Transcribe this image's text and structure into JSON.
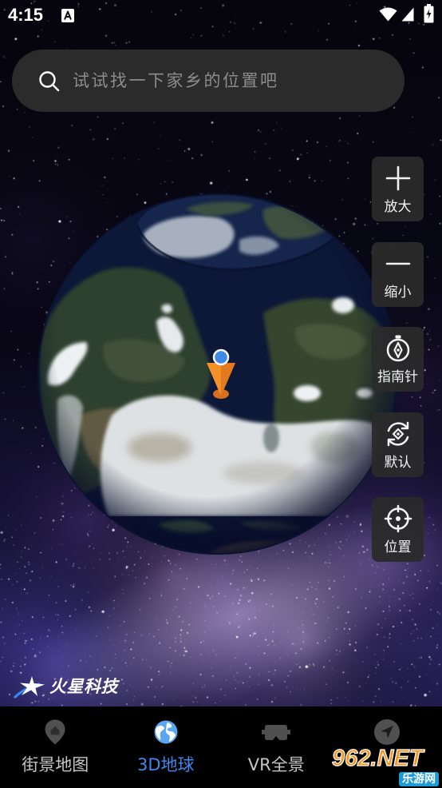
{
  "status_bar": {
    "time": "4:15",
    "icons": [
      "a-letter-icon",
      "wifi-icon",
      "signal-icon",
      "battery-charging-icon"
    ]
  },
  "search": {
    "placeholder": "试试找一下家乡的位置吧",
    "icon": "search-icon"
  },
  "map_controls": [
    {
      "label": "放大",
      "icon": "plus-icon"
    },
    {
      "label": "缩小",
      "icon": "minus-icon"
    },
    {
      "label": "指南针",
      "icon": "compass-icon"
    },
    {
      "label": "默认",
      "icon": "reset-view-icon"
    },
    {
      "label": "位置",
      "icon": "locate-icon"
    }
  ],
  "globe": {
    "marker_icon": "location-pin-icon"
  },
  "brand": {
    "name": "火星科技",
    "icon": "star-logo-icon"
  },
  "bottom_nav": {
    "active_index": 1,
    "tabs": [
      {
        "label": "街景地图",
        "icon": "map-pin-icon"
      },
      {
        "label": "3D地球",
        "icon": "globe-icon"
      },
      {
        "label": "VR全景",
        "icon": "vr-goggles-icon"
      },
      {
        "icon": "navigation-arrow-icon"
      }
    ]
  },
  "watermark": {
    "line1": "962.NET",
    "line2": "乐游网"
  },
  "colors": {
    "accent": "#3f86ef",
    "accent_icon": "#5aa6f2",
    "tab_inactive": "#c6c6c6",
    "icon_inactive": "#505050",
    "panel": "#2b2b2b"
  }
}
